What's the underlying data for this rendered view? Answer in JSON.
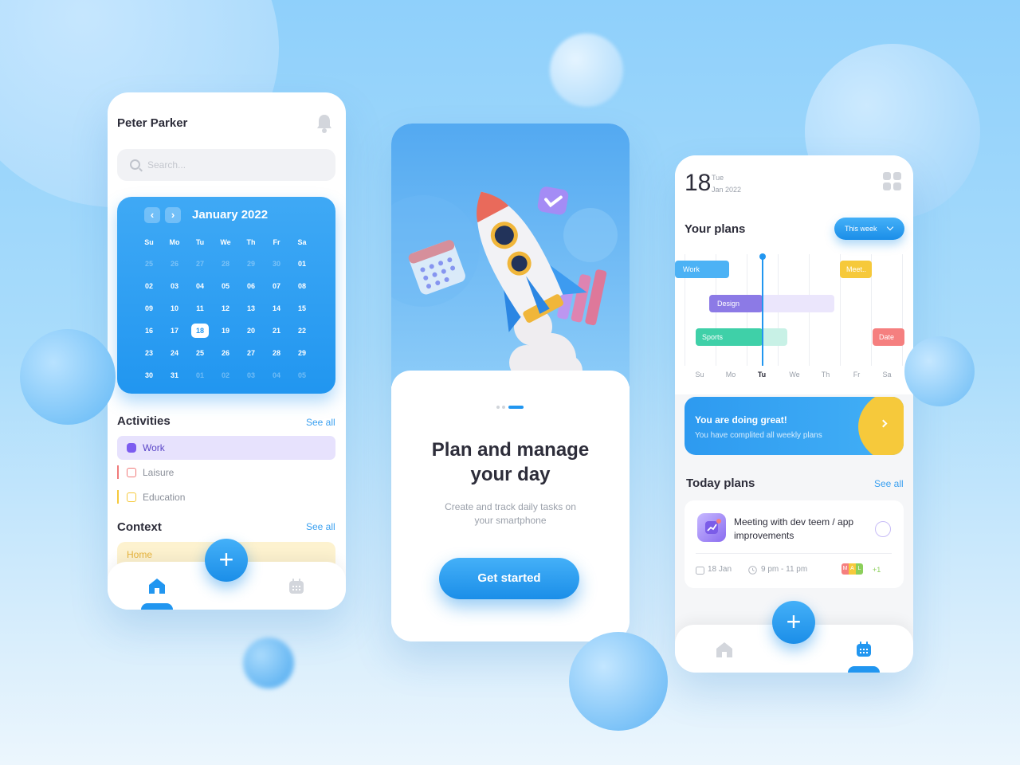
{
  "phone1": {
    "user_name": "Peter Parker",
    "search_placeholder": "Search...",
    "calendar": {
      "month": "January 2022",
      "weekdays": [
        "Su",
        "Mo",
        "Tu",
        "We",
        "Th",
        "Fr",
        "Sa"
      ],
      "weeks": [
        [
          "25",
          "26",
          "27",
          "28",
          "29",
          "30",
          "01"
        ],
        [
          "02",
          "03",
          "04",
          "05",
          "06",
          "07",
          "08"
        ],
        [
          "09",
          "10",
          "11",
          "12",
          "13",
          "14",
          "15"
        ],
        [
          "16",
          "17",
          "18",
          "19",
          "20",
          "21",
          "22"
        ],
        [
          "23",
          "24",
          "25",
          "26",
          "27",
          "28",
          "29"
        ],
        [
          "30",
          "31",
          "01",
          "02",
          "03",
          "04",
          "05"
        ]
      ],
      "selected": "18"
    },
    "activities_title": "Activities",
    "activities_see_all": "See all",
    "activities": [
      {
        "label": "Work",
        "color": "#7c5cf0"
      },
      {
        "label": "Laisure",
        "color": "#f07a7a"
      },
      {
        "label": "Education",
        "color": "#f6c93b"
      }
    ],
    "context_title": "Context",
    "context_see_all": "See all",
    "context_item": "Home",
    "fab_label": "+"
  },
  "phone2": {
    "headline_line1": "Plan and manage",
    "headline_line2": "your day",
    "subtitle_line1": "Create and track daily tasks on",
    "subtitle_line2": "your smartphone",
    "cta": "Get started",
    "pager": {
      "pages": 3,
      "active": 3
    }
  },
  "phone3": {
    "day": "18",
    "weekday": "Tue",
    "month_year": "Jan 2022",
    "plans_title": "Your plans",
    "range_button": "This week",
    "gantt_days": [
      "Su",
      "Mo",
      "Tu",
      "We",
      "Th",
      "Fr",
      "Sa"
    ],
    "current_day": "Tu",
    "gantt_bars": [
      {
        "label": "Work",
        "color": "#4cb2f5"
      },
      {
        "label": "Meet..",
        "color": "#f6c93b"
      },
      {
        "label": "Design",
        "color": "#8c7ae6"
      },
      {
        "label": "Sports",
        "color": "#3fd0a8"
      },
      {
        "label": "Date",
        "color": "#f57f7f"
      }
    ],
    "banner_title": "You are doing great!",
    "banner_sub": "You have complited all weekly plans",
    "today_title": "Today plans",
    "today_see_all": "See all",
    "task": {
      "title": "Meeting with dev teem / app improvements",
      "date": "18 Jan",
      "time": "9 pm - 11 pm",
      "tags": [
        "M",
        "A",
        "L"
      ],
      "tag_colors": [
        "#f57f7f",
        "#f6c93b",
        "#8ccf5a"
      ],
      "more": "+1"
    },
    "fab_label": "+"
  }
}
